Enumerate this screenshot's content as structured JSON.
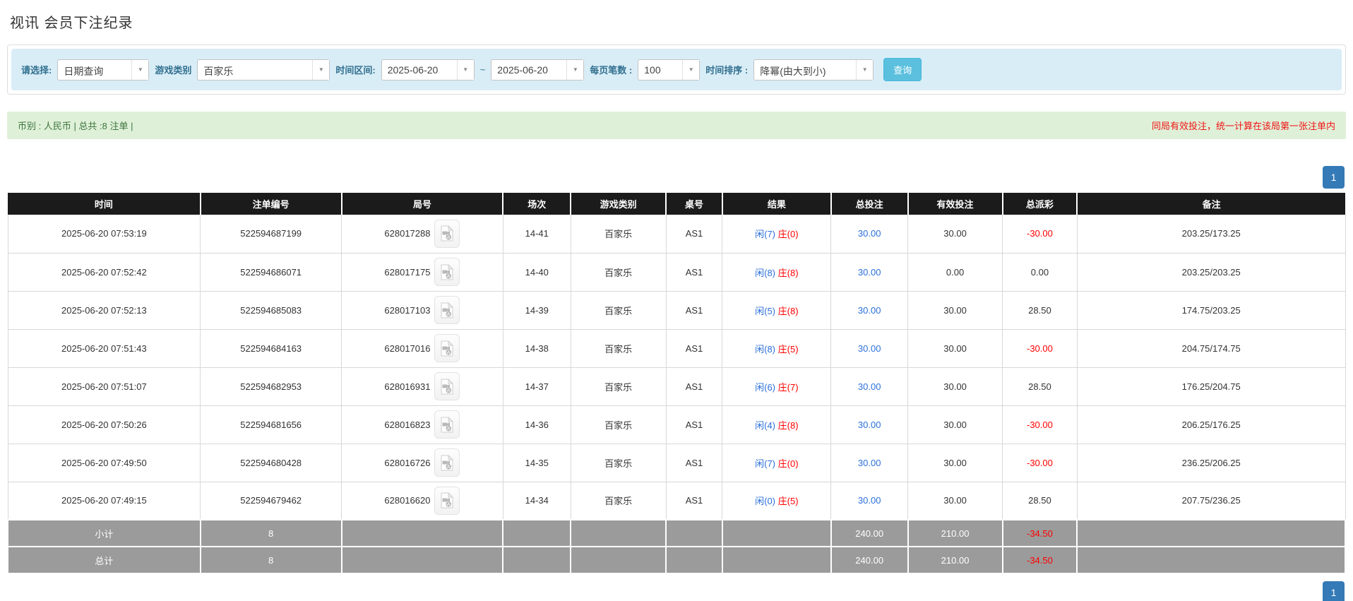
{
  "page": {
    "title": "视讯 会员下注纪录"
  },
  "icons": {
    "dropdown_caret": "▼",
    "video_record": "film-document-icon"
  },
  "filters": {
    "query_type": {
      "label": "请选择:",
      "value": "日期查询"
    },
    "game_category": {
      "label": "游戏类别",
      "value": "百家乐"
    },
    "date_range": {
      "label": "时间区间:",
      "from": "2025-06-20",
      "separator": "~",
      "to": "2025-06-20"
    },
    "page_size": {
      "label": "每页笔数 :",
      "value": "100"
    },
    "sort": {
      "label": "时间排序 :",
      "value": "降幂(由大到小)"
    },
    "search_button": "查询"
  },
  "summary": {
    "left": "币别 : 人民币 | 总共 :8 注单 |",
    "right": "同局有效投注，统一计算在该局第一张注单内"
  },
  "pagination": {
    "page": "1"
  },
  "table": {
    "columns": [
      "时间",
      "注单编号",
      "局号",
      "场次",
      "游戏类别",
      "桌号",
      "结果",
      "总投注",
      "有效投注",
      "总派彩",
      "备注"
    ],
    "rows": [
      {
        "time": "2025-06-20 07:53:19",
        "bet_id": "522594687199",
        "round_id": "628017288",
        "session": "14-41",
        "game": "百家乐",
        "table_no": "AS1",
        "result_player": "闲(7)",
        "result_banker": "庄(0)",
        "total_bet": "30.00",
        "valid_bet": "30.00",
        "payout": "-30.00",
        "note": "203.25/173.25"
      },
      {
        "time": "2025-06-20 07:52:42",
        "bet_id": "522594686071",
        "round_id": "628017175",
        "session": "14-40",
        "game": "百家乐",
        "table_no": "AS1",
        "result_player": "闲(8)",
        "result_banker": "庄(8)",
        "total_bet": "30.00",
        "valid_bet": "0.00",
        "payout": "0.00",
        "note": "203.25/203.25"
      },
      {
        "time": "2025-06-20 07:52:13",
        "bet_id": "522594685083",
        "round_id": "628017103",
        "session": "14-39",
        "game": "百家乐",
        "table_no": "AS1",
        "result_player": "闲(5)",
        "result_banker": "庄(8)",
        "total_bet": "30.00",
        "valid_bet": "30.00",
        "payout": "28.50",
        "note": "174.75/203.25"
      },
      {
        "time": "2025-06-20 07:51:43",
        "bet_id": "522594684163",
        "round_id": "628017016",
        "session": "14-38",
        "game": "百家乐",
        "table_no": "AS1",
        "result_player": "闲(8)",
        "result_banker": "庄(5)",
        "total_bet": "30.00",
        "valid_bet": "30.00",
        "payout": "-30.00",
        "note": "204.75/174.75"
      },
      {
        "time": "2025-06-20 07:51:07",
        "bet_id": "522594682953",
        "round_id": "628016931",
        "session": "14-37",
        "game": "百家乐",
        "table_no": "AS1",
        "result_player": "闲(6)",
        "result_banker": "庄(7)",
        "total_bet": "30.00",
        "valid_bet": "30.00",
        "payout": "28.50",
        "note": "176.25/204.75"
      },
      {
        "time": "2025-06-20 07:50:26",
        "bet_id": "522594681656",
        "round_id": "628016823",
        "session": "14-36",
        "game": "百家乐",
        "table_no": "AS1",
        "result_player": "闲(4)",
        "result_banker": "庄(8)",
        "total_bet": "30.00",
        "valid_bet": "30.00",
        "payout": "-30.00",
        "note": "206.25/176.25"
      },
      {
        "time": "2025-06-20 07:49:50",
        "bet_id": "522594680428",
        "round_id": "628016726",
        "session": "14-35",
        "game": "百家乐",
        "table_no": "AS1",
        "result_player": "闲(7)",
        "result_banker": "庄(0)",
        "total_bet": "30.00",
        "valid_bet": "30.00",
        "payout": "-30.00",
        "note": "236.25/206.25"
      },
      {
        "time": "2025-06-20 07:49:15",
        "bet_id": "522594679462",
        "round_id": "628016620",
        "session": "14-34",
        "game": "百家乐",
        "table_no": "AS1",
        "result_player": "闲(0)",
        "result_banker": "庄(5)",
        "total_bet": "30.00",
        "valid_bet": "30.00",
        "payout": "28.50",
        "note": "207.75/236.25"
      }
    ],
    "subtotal": {
      "label": "小计",
      "count": "8",
      "total_bet": "240.00",
      "valid_bet": "210.00",
      "payout": "-34.50"
    },
    "total": {
      "label": "总计",
      "count": "8",
      "total_bet": "240.00",
      "valid_bet": "210.00",
      "payout": "-34.50"
    }
  },
  "colors": {
    "accent_blue": "#337ab7",
    "link_blue": "#2b6fdb",
    "negative_red": "#ff0000",
    "info_bg": "#d9edf7",
    "info_text": "#31708f",
    "success_bg": "#dff0d8",
    "success_text": "#3c763d",
    "header_bg": "#1b1b1b",
    "footer_bg": "#9b9b9b",
    "search_btn": "#5bc0de"
  }
}
